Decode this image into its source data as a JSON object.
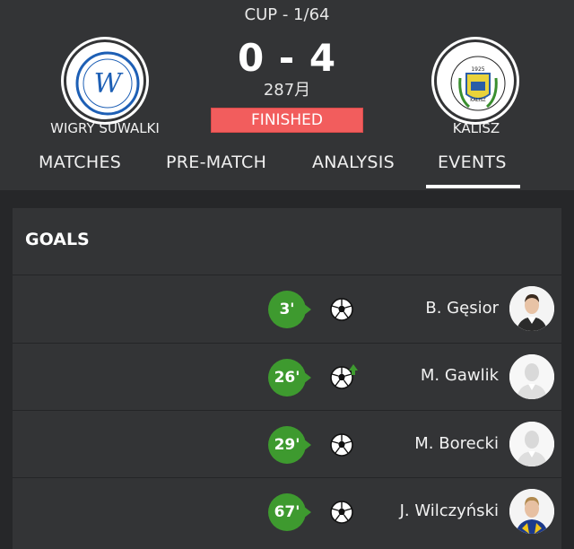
{
  "match": {
    "competition": "CUP - 1/64",
    "score": "0 - 4",
    "elapsed": "287月",
    "status": "FINISHED",
    "status_color": "#f25d5d",
    "home_team": {
      "name": "WIGRY SUWALKI",
      "crest_icon": "wigry-crest-icon"
    },
    "away_team": {
      "name": "KALISZ",
      "crest_icon": "kalisz-crest-icon"
    }
  },
  "tabs": [
    {
      "label": "MATCHES"
    },
    {
      "label": "PRE-MATCH"
    },
    {
      "label": "ANALYSIS"
    },
    {
      "label": "EVENTS",
      "active": true
    }
  ],
  "events": {
    "section_title": "GOALS",
    "goals": [
      {
        "minute": "3'",
        "player": "B. Gęsior",
        "icon": "soccer-ball-icon",
        "avatar": "photo"
      },
      {
        "minute": "26'",
        "player": "M. Gawlik",
        "icon": "soccer-ball-assist-icon",
        "avatar": "placeholder"
      },
      {
        "minute": "29'",
        "player": "M. Borecki",
        "icon": "soccer-ball-icon",
        "avatar": "placeholder"
      },
      {
        "minute": "67'",
        "player": "J. Wilczyński",
        "icon": "soccer-ball-icon",
        "avatar": "photo"
      }
    ],
    "accent_color": "#3e9a2f"
  }
}
